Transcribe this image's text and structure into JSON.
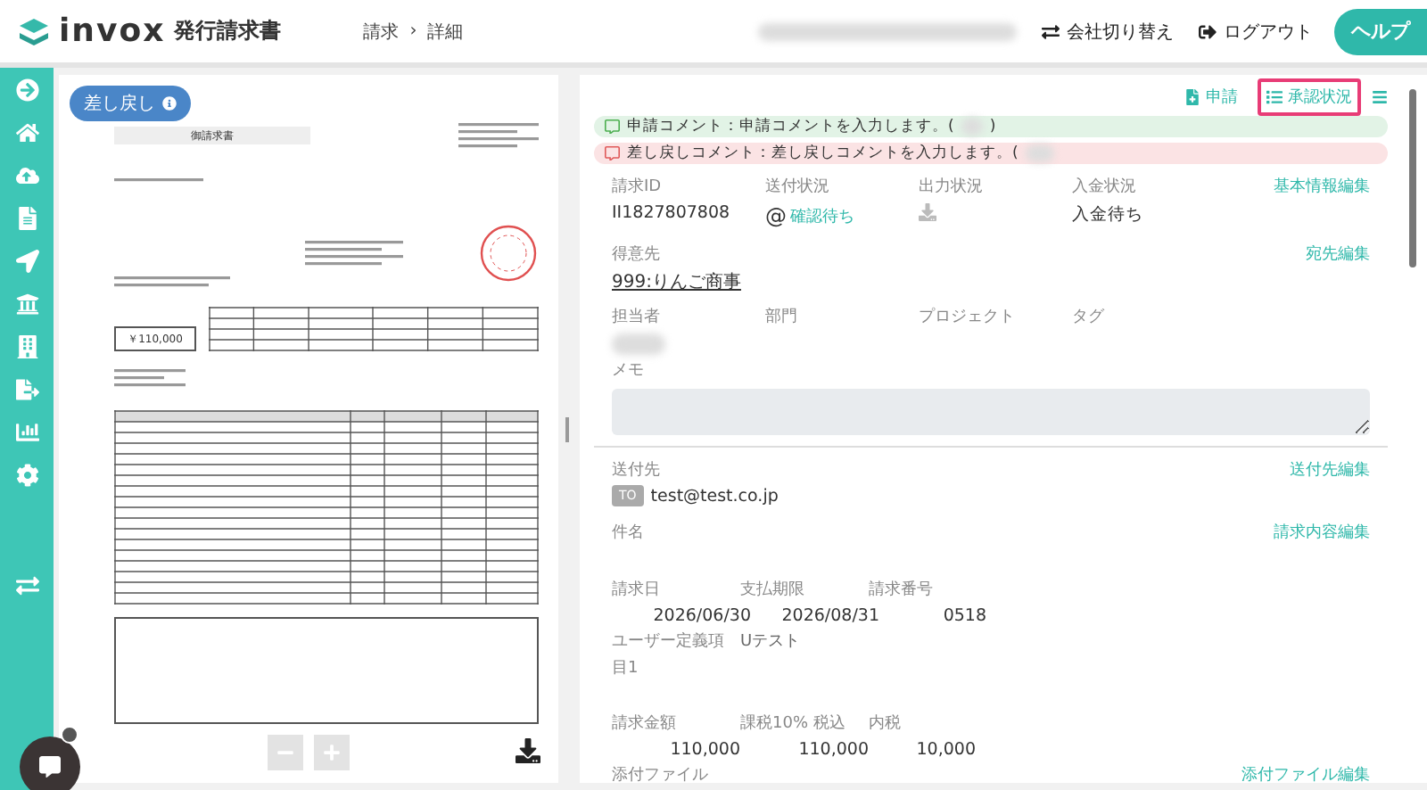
{
  "header": {
    "logo": "invox",
    "product": "発行請求書",
    "breadcrumb": [
      "請求",
      "詳細"
    ],
    "separator": "›",
    "actions": [
      {
        "kind": "switch",
        "label": "会社切り替え"
      },
      {
        "kind": "logout",
        "label": "ログアウト"
      }
    ],
    "help": "ヘルプ"
  },
  "sidebar": {
    "items": [
      {
        "kind": "arrow"
      },
      {
        "kind": "home"
      },
      {
        "kind": "upload"
      },
      {
        "kind": "doc"
      },
      {
        "kind": "send"
      },
      {
        "kind": "bank"
      },
      {
        "kind": "building"
      },
      {
        "kind": "export"
      },
      {
        "kind": "chart"
      },
      {
        "kind": "gear"
      },
      {
        "kind": "swap"
      }
    ]
  },
  "preview": {
    "badge": "差し戻し",
    "document": {
      "title": "御請求書",
      "amount": "￥110,000"
    }
  },
  "detail": {
    "toolbar": [
      {
        "kind": "apply",
        "label": "申請",
        "selected": false
      },
      {
        "kind": "status",
        "label": "承認状況",
        "selected": true
      }
    ],
    "comments": [
      {
        "kind": "apply",
        "text": "申請コメント：申請コメントを入力します。(",
        "close": ")"
      },
      {
        "kind": "return",
        "text": "差し戻しコメント：差し戻しコメントを入力します。("
      }
    ],
    "basic": {
      "edit": "基本情報編集",
      "fields": [
        {
          "label": "請求ID",
          "value": "II1827807808",
          "kind": "text"
        },
        {
          "label": "送付状況",
          "value": "確認待ち",
          "mark": "@",
          "kind": "mail"
        },
        {
          "label": "出力状況",
          "kind": "download"
        },
        {
          "label": "入金状況",
          "value": "入金待ち",
          "kind": "text"
        }
      ]
    },
    "client": {
      "label": "得意先",
      "value": "999:りんご商事",
      "edit": "宛先編集"
    },
    "assign": [
      {
        "label": "担当者",
        "blurred": true
      },
      {
        "label": "部門",
        "blurred": false
      },
      {
        "label": "プロジェクト",
        "blurred": false
      },
      {
        "label": "タグ",
        "blurred": false
      }
    ],
    "memo": {
      "label": "メモ"
    },
    "send": {
      "label": "送付先",
      "edit": "送付先編集",
      "tag": "TO",
      "email": "test@test.co.jp"
    },
    "subject": {
      "label": "件名",
      "edit": "請求内容編集"
    },
    "dates": [
      {
        "label": "請求日",
        "value": "2026/06/30"
      },
      {
        "label": "支払期限",
        "value": "2026/08/31"
      },
      {
        "label": "請求番号",
        "value": "0518"
      }
    ],
    "custom": [
      {
        "label": "ユーザー定義項目1",
        "value": "Uテスト"
      }
    ],
    "amounts": [
      {
        "label": "請求金額",
        "value": "110,000"
      },
      {
        "label": "課税10% 税込",
        "value": "110,000"
      },
      {
        "label": "内税",
        "value": "10,000"
      }
    ],
    "attach": {
      "label": "添付ファイル",
      "edit": "添付ファイル編集"
    }
  }
}
